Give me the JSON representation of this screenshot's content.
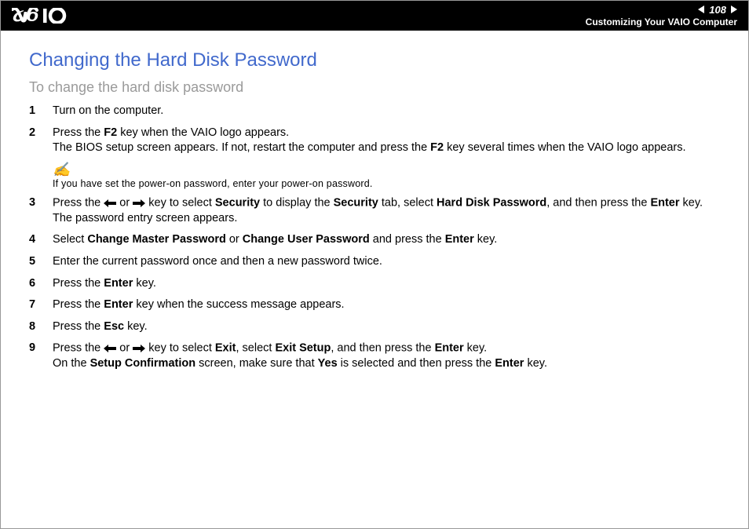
{
  "header": {
    "page_number": "108",
    "section": "Customizing Your VAIO Computer"
  },
  "title": "Changing the Hard Disk Password",
  "subtitle": "To change the hard disk password",
  "note": {
    "text": "If you have set the power-on password, enter your power-on password."
  },
  "steps": {
    "s1": {
      "num": "1",
      "text": "Turn on the computer."
    },
    "s2": {
      "num": "2",
      "l1a": "Press the ",
      "l1b": "F2",
      "l1c": " key when the VAIO logo appears.",
      "l2a": "The BIOS setup screen appears. If not, restart the computer and press the ",
      "l2b": "F2",
      "l2c": " key several times when the VAIO logo appears."
    },
    "s3": {
      "num": "3",
      "a": "Press the ",
      "b": " or ",
      "c": " key to select ",
      "d": "Security",
      "e": " to display the ",
      "f": "Security",
      "g": " tab, select ",
      "h": "Hard Disk Password",
      "i": ", and then press the ",
      "j": "Enter",
      "k": " key.",
      "l2": "The password entry screen appears."
    },
    "s4": {
      "num": "4",
      "a": "Select ",
      "b": "Change Master Password",
      "c": " or ",
      "d": "Change User Password",
      "e": " and press the ",
      "f": "Enter",
      "g": " key."
    },
    "s5": {
      "num": "5",
      "text": "Enter the current password once and then a new password twice."
    },
    "s6": {
      "num": "6",
      "a": "Press the ",
      "b": "Enter",
      "c": " key."
    },
    "s7": {
      "num": "7",
      "a": "Press the ",
      "b": "Enter",
      "c": " key when the success message appears."
    },
    "s8": {
      "num": "8",
      "a": "Press the ",
      "b": "Esc",
      "c": " key."
    },
    "s9": {
      "num": "9",
      "a": "Press the ",
      "b": " or ",
      "c": " key to select ",
      "d": "Exit",
      "e": ", select ",
      "f": "Exit Setup",
      "g": ", and then press the ",
      "h": "Enter",
      "i": " key.",
      "l2a": "On the ",
      "l2b": "Setup Confirmation",
      "l2c": " screen, make sure that ",
      "l2d": "Yes",
      "l2e": " is selected and then press the ",
      "l2f": "Enter",
      "l2g": " key."
    }
  }
}
